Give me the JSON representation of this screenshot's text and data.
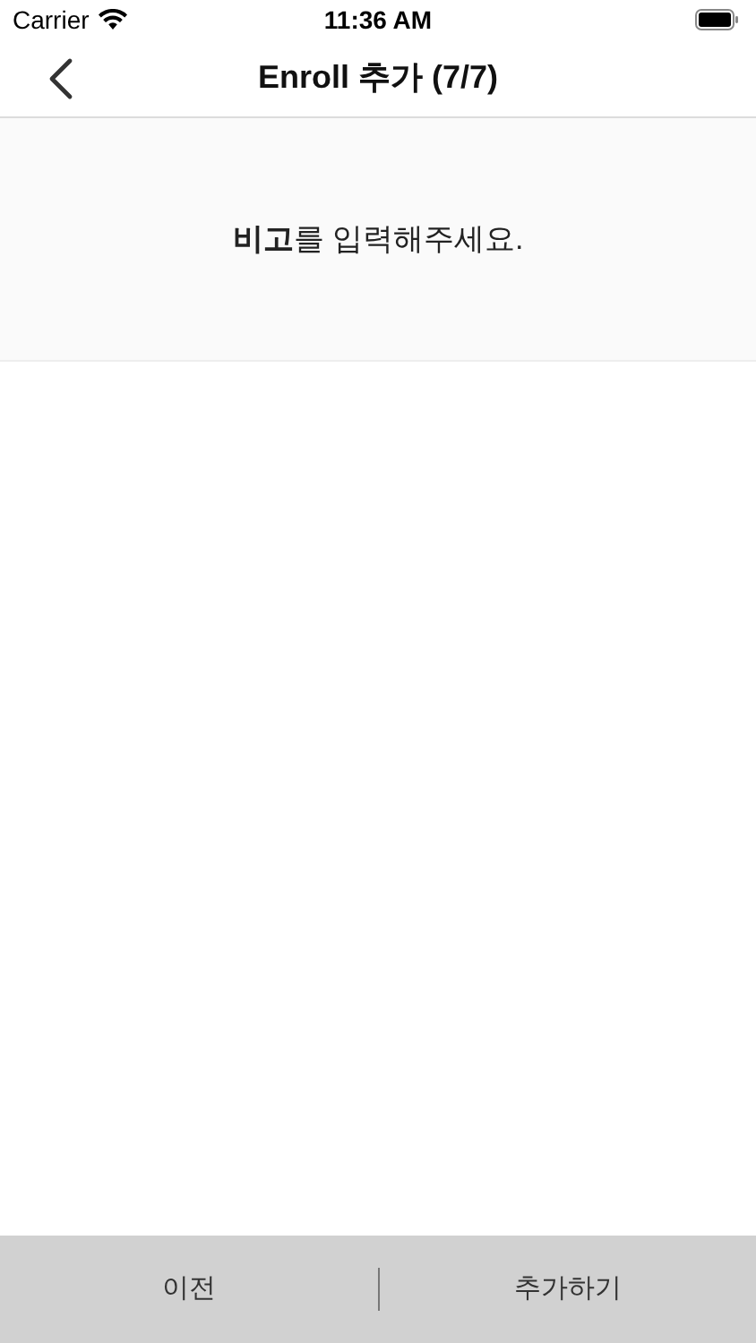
{
  "status_bar": {
    "carrier": "Carrier",
    "time": "11:36 AM"
  },
  "nav_bar": {
    "title": "Enroll 추가 (7/7)"
  },
  "prompt": "**비고**를 입력해주세요.",
  "bottom_bar": {
    "buttons": [
      {
        "label": "이전"
      },
      {
        "label": "추가하기"
      }
    ]
  }
}
